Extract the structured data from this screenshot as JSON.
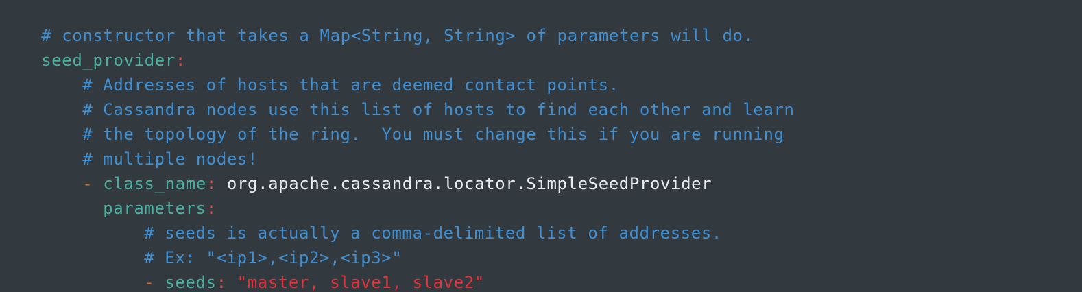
{
  "editor": {
    "lines": {
      "l1": "# constructor that takes a Map<String, String> of parameters will do.",
      "l2_key": "seed_provider",
      "l2_colon": ":",
      "l3": "# Addresses of hosts that are deemed contact points.",
      "l4": "# Cassandra nodes use this list of hosts to find each other and learn",
      "l5": "# the topology of the ring.  You must change this if you are running",
      "l6": "# multiple nodes!",
      "l7_dash": "- ",
      "l7_key": "class_name",
      "l7_colon": ": ",
      "l7_value": "org.apache.cassandra.locator.SimpleSeedProvider",
      "l8_key": "parameters",
      "l8_colon": ":",
      "l9": "# seeds is actually a comma-delimited list of addresses.",
      "l10": "# Ex: \"<ip1>,<ip2>,<ip3>\"",
      "l11_dash": "- ",
      "l11_key": "seeds",
      "l11_colon": ": ",
      "l11_value": "\"master, slave1, slave2\""
    },
    "colors": {
      "background": "#333a3f",
      "comment": "#3f8fd2",
      "key": "#4cb0a0",
      "punctuation": "#d9534f",
      "dash": "#e1692d",
      "plain_value": "#e8ecef",
      "string_value": "#e0333b"
    }
  }
}
